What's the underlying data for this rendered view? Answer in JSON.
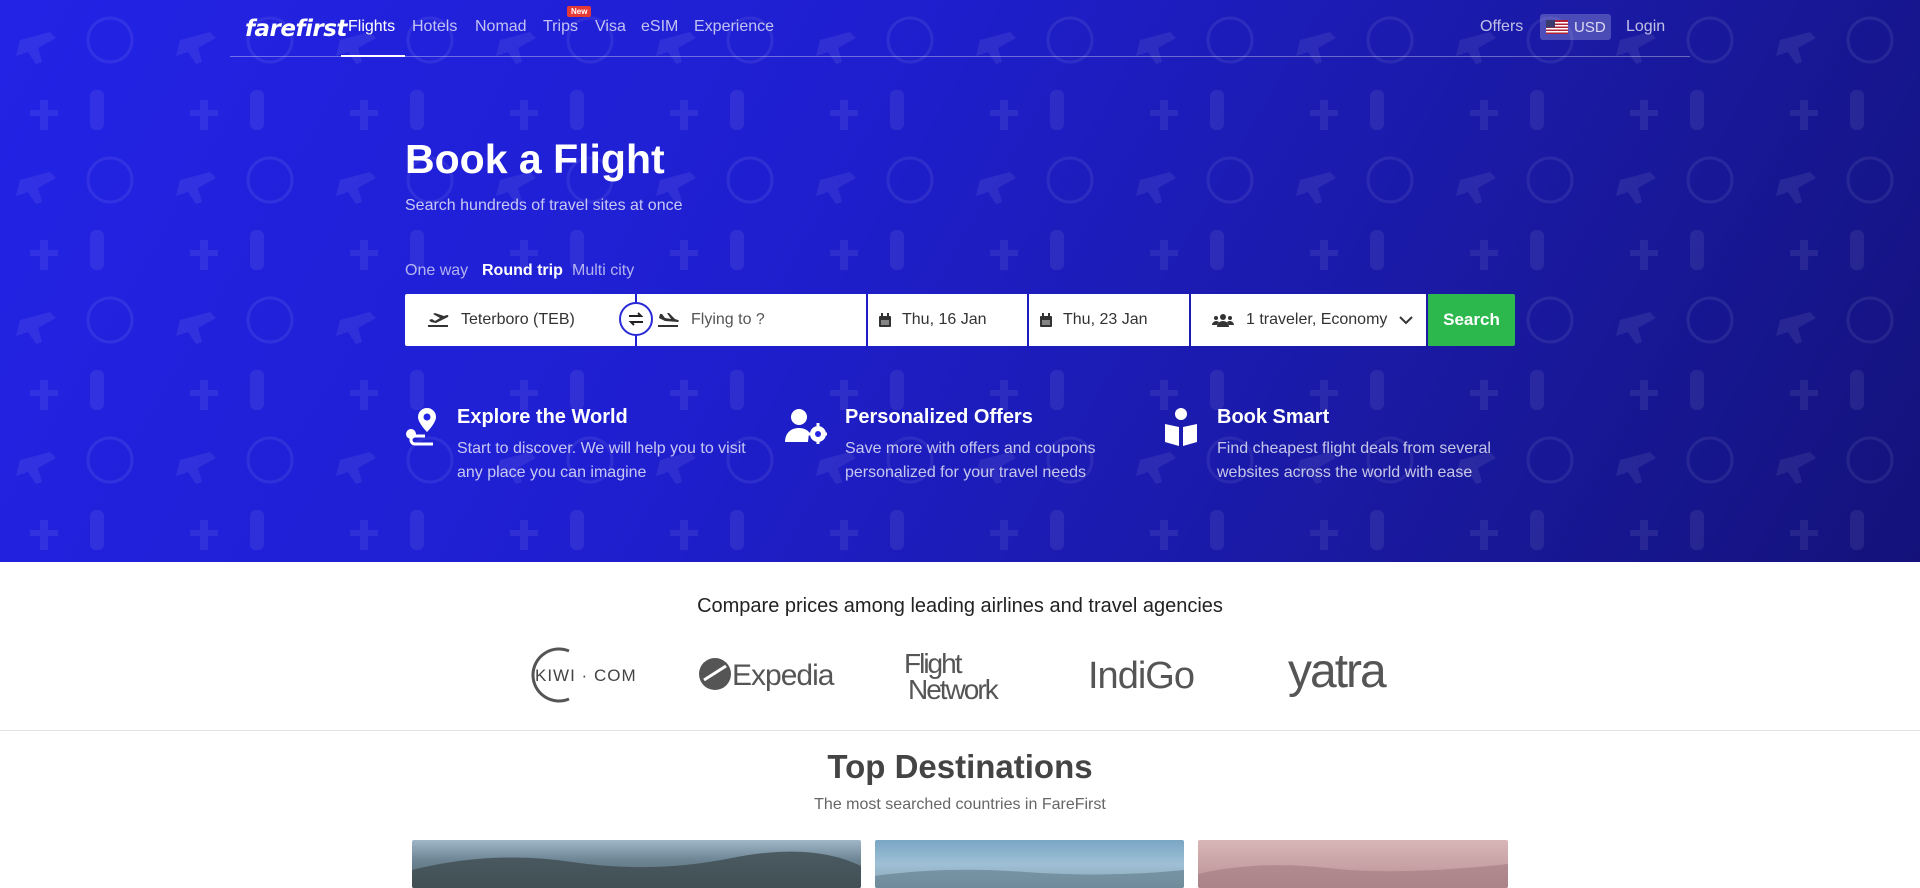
{
  "nav": {
    "logo": "farefirst",
    "items": [
      {
        "label": "Flights",
        "active": true
      },
      {
        "label": "Hotels"
      },
      {
        "label": "Nomad"
      },
      {
        "label": "Trips",
        "badge": "New"
      },
      {
        "label": "Visa"
      },
      {
        "label": "eSIM"
      },
      {
        "label": "Experience"
      }
    ],
    "offers": "Offers",
    "currency": "USD",
    "login": "Login"
  },
  "hero": {
    "title": "Book a Flight",
    "subtitle": "Search hundreds of travel sites at once"
  },
  "trip_types": [
    {
      "label": "One way"
    },
    {
      "label": "Round trip",
      "active": true
    },
    {
      "label": "Multi city"
    }
  ],
  "search": {
    "from": "Teterboro (TEB)",
    "to_placeholder": "Flying to ?",
    "depart": "Thu, 16 Jan",
    "return": "Thu, 23 Jan",
    "travelers": "1 traveler, Economy",
    "button": "Search"
  },
  "features": [
    {
      "icon": "route-pin-icon",
      "title": "Explore the World",
      "desc1": "Start to discover. We will help you to visit",
      "desc2": "any place you can imagine"
    },
    {
      "icon": "user-gear-icon",
      "title": "Personalized Offers",
      "desc1": "Save more with offers and coupons",
      "desc2": "personalized for your travel needs"
    },
    {
      "icon": "open-book-icon",
      "title": "Book Smart",
      "desc1": "Find cheapest flight deals from several",
      "desc2": "websites across the world with ease"
    }
  ],
  "partners": {
    "heading": "Compare prices among leading airlines and travel agencies",
    "logos": [
      "KIWI · COM",
      "Expedia",
      "Flight Network",
      "IndiGo",
      "yatra"
    ]
  },
  "destinations": {
    "title": "Top Destinations",
    "subtitle": "The most searched countries in FareFirst"
  },
  "colors": {
    "hero_start": "#2323e6",
    "hero_end": "#14127a",
    "search_button": "#2db84d",
    "badge": "#e53935"
  }
}
